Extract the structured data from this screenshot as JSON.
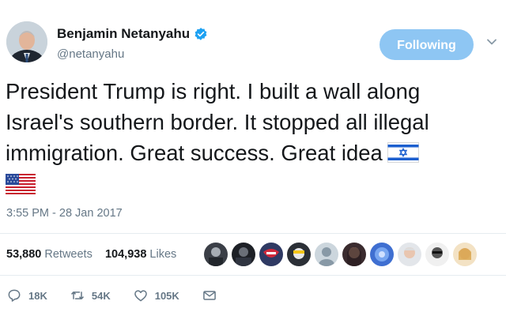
{
  "user": {
    "name": "Benjamin Netanyahu",
    "handle": "@netanyahu",
    "verified": true
  },
  "follow_button": {
    "label": "Following",
    "color": "#8ec6f3"
  },
  "tweet": {
    "lines": [
      "President Trump is right. I built a wall along",
      "Israel's southern border. It stopped all illegal",
      "immigration. Great success. Great idea"
    ],
    "emoji": [
      "israel-flag",
      "us-flag"
    ],
    "timestamp": "3:55 PM - 28 Jan 2017"
  },
  "stats": {
    "retweets_count": "53,880",
    "retweets_label": "Retweets",
    "likes_count": "104,938",
    "likes_label": "Likes"
  },
  "actions": {
    "reply_count": "18K",
    "retweet_count": "54K",
    "like_count": "105K"
  },
  "colors": {
    "text": "#14171a",
    "secondary": "#657786",
    "verified_blue": "#1da1f2",
    "divider": "#e6ecf0"
  }
}
